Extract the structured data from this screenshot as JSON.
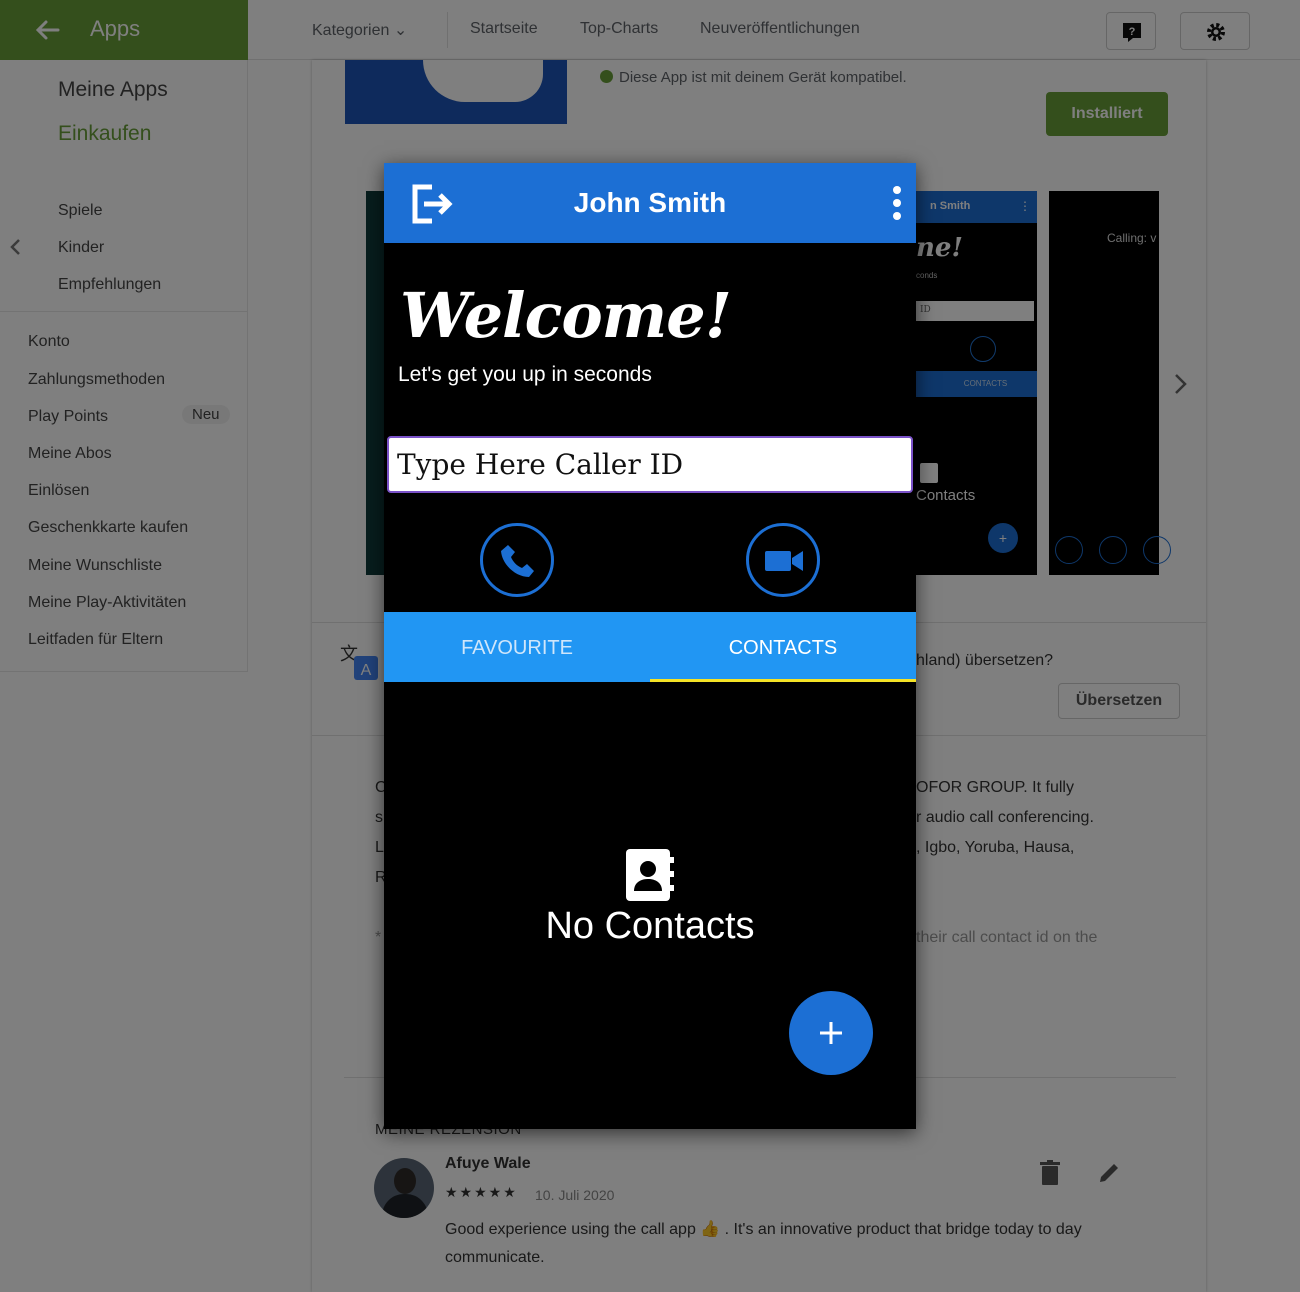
{
  "topbar": {
    "app_title": "Apps",
    "nav": [
      "Kategorien",
      "Startseite",
      "Top-Charts",
      "Neuveröffentlichungen"
    ],
    "help_icon": "help-icon",
    "settings_icon": "gear-icon"
  },
  "sidebar": {
    "primary": [
      "Meine Apps",
      "Einkaufen"
    ],
    "active_item": "Einkaufen",
    "sections": [
      "Spiele",
      "Kinder",
      "Empfehlungen"
    ],
    "account": [
      "Konto",
      "Zahlungsmethoden",
      "Play Points",
      "Meine Abos",
      "Einlösen",
      "Geschenkkarte kaufen",
      "Meine Wunschliste",
      "Meine Play-Aktivitäten",
      "Leitfaden für Eltern"
    ],
    "badge_neu": "Neu"
  },
  "app_page": {
    "compat_text": "Diese App ist mit deinem Gerät kompatibel.",
    "install_label": "Installiert",
    "screenshot_mini": {
      "bar_text": "n Smith",
      "welcome": "ne!",
      "seconds": "conds",
      "input": "ID",
      "tab": "CONTACTS",
      "no_contacts": "Contacts"
    },
    "screenshot_call": {
      "label": "Calling: v"
    },
    "translate_text": "hland) übersetzen?",
    "translate_button": "Übersetzen",
    "description_lines": [
      {
        "left": "C",
        "right": "OFOR GROUP. It fully"
      },
      {
        "left": "s",
        "right": "r audio call conferencing."
      },
      {
        "left": "L",
        "right": ", Igbo, Yoruba, Hausa,"
      },
      {
        "left": "R",
        "right": ""
      }
    ],
    "description_faded": {
      "left": "*",
      "right": "their call contact id on the"
    }
  },
  "review": {
    "heading": "MEINE REZENSION",
    "author": "Afuye Wale",
    "stars": "★★★★★",
    "date": "10. Juli 2020",
    "text_line1": "Good experience using the call app 👍 . It's an innovative product that bridge today to day",
    "text_line2": "communicate."
  },
  "modal": {
    "title": "John Smith",
    "welcome": "Welcome!",
    "subtitle": "Let's get you up in seconds",
    "input_placeholder": "Type Here Caller ID",
    "tabs": [
      "FAVOURITE",
      "CONTACTS"
    ],
    "active_tab": "CONTACTS",
    "empty_text": "No Contacts",
    "colors": {
      "bar": "#1c6fd4",
      "tabs": "#2196f3",
      "underline": "#f5e326"
    }
  }
}
